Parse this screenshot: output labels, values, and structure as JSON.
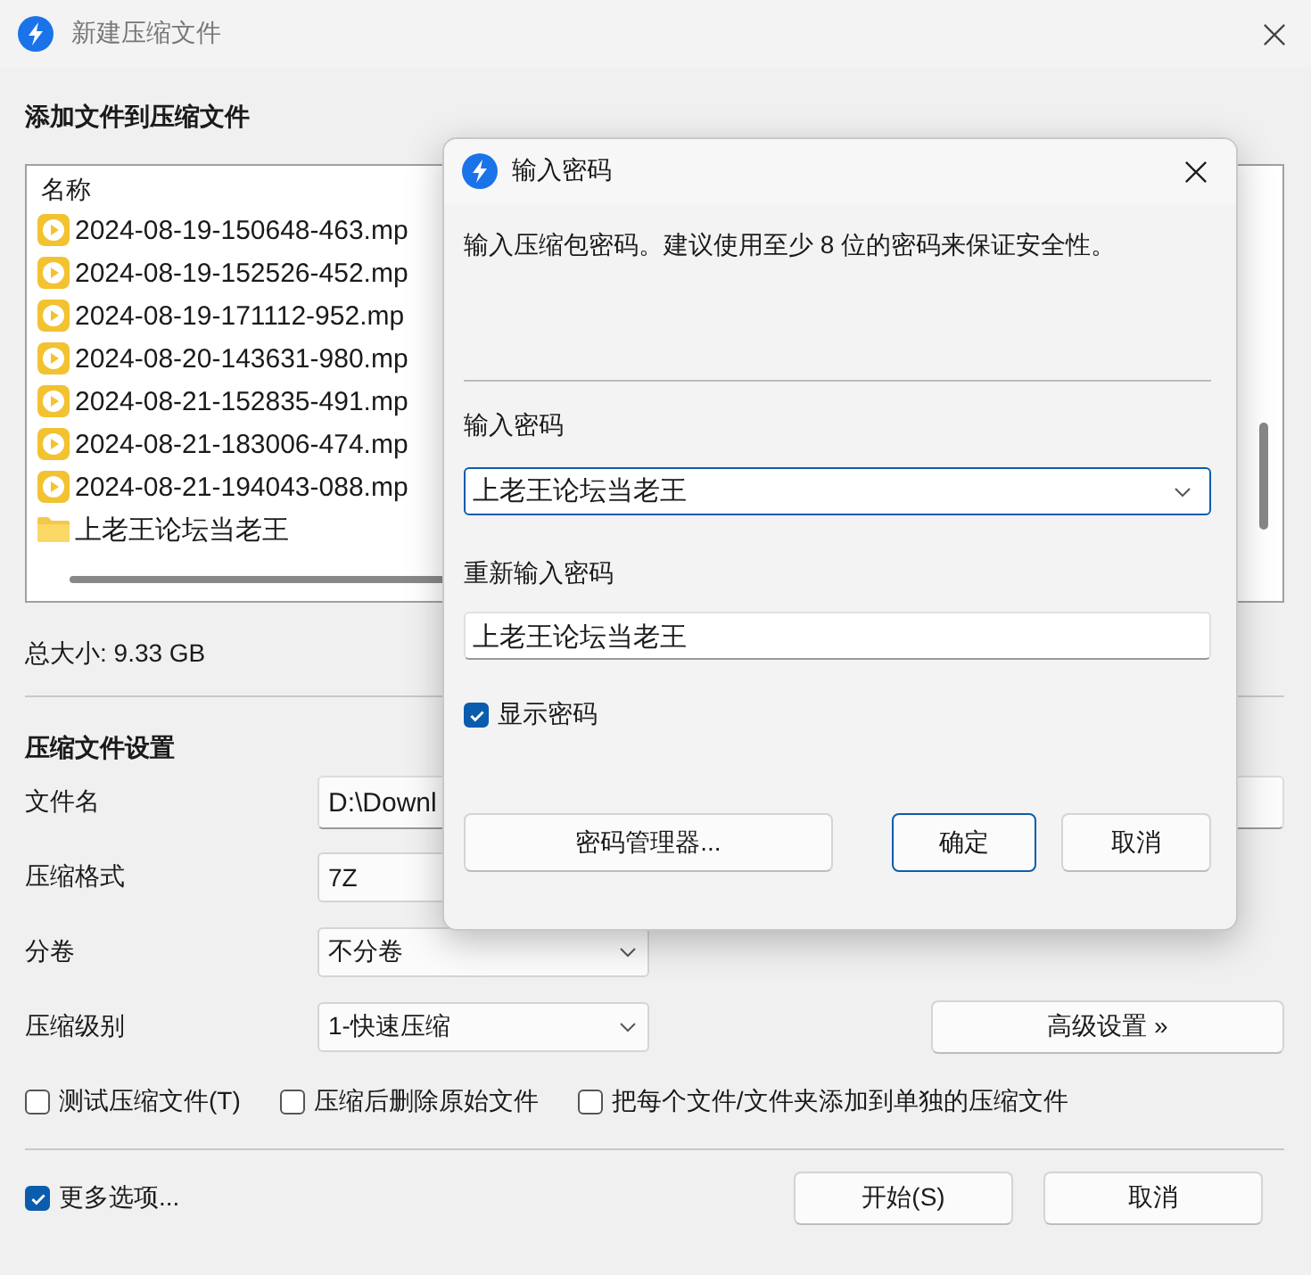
{
  "window": {
    "title": "新建压缩文件"
  },
  "files": {
    "heading": "添加文件到压缩文件",
    "column": "名称",
    "items": [
      {
        "name": "2024-08-19-150648-463.mp",
        "kind": "video"
      },
      {
        "name": "2024-08-19-152526-452.mp",
        "kind": "video"
      },
      {
        "name": "2024-08-19-171112-952.mp",
        "kind": "video"
      },
      {
        "name": "2024-08-20-143631-980.mp",
        "kind": "video"
      },
      {
        "name": "2024-08-21-152835-491.mp",
        "kind": "video"
      },
      {
        "name": "2024-08-21-183006-474.mp",
        "kind": "video"
      },
      {
        "name": "2024-08-21-194043-088.mp",
        "kind": "video"
      },
      {
        "name": "上老王论坛当老王",
        "kind": "folder"
      }
    ]
  },
  "total_size": "总大小: 9.33 GB",
  "settings": {
    "heading": "压缩文件设置",
    "fields": [
      {
        "label": "文件名",
        "value": "D:\\Downl",
        "kind": "text"
      },
      {
        "label": "压缩格式",
        "value": "7Z",
        "kind": "box"
      },
      {
        "label": "分卷",
        "value": "不分卷",
        "kind": "select"
      },
      {
        "label": "压缩级别",
        "value": "1-快速压缩",
        "kind": "select"
      }
    ],
    "advanced_button": "高级设置 »",
    "options": [
      {
        "label": "测试压缩文件(T)",
        "checked": false
      },
      {
        "label": "压缩后删除原始文件",
        "checked": false
      },
      {
        "label": "把每个文件/文件夹添加到单独的压缩文件",
        "checked": false
      }
    ]
  },
  "more_options": {
    "label": "更多选项...",
    "checked": true
  },
  "buttons": [
    "开始(S)",
    "取消"
  ],
  "dialog": {
    "title": "输入密码",
    "description": "输入压缩包密码。建议使用至少 8 位的密码来保证安全性。",
    "password_label": "输入密码",
    "password": "上老王论坛当老王",
    "confirm_label": "重新输入密码",
    "confirm": "上老王论坛当老王",
    "show_password": {
      "label": "显示密码",
      "checked": true
    },
    "buttons": [
      {
        "label": "密码管理器...",
        "default": false
      },
      {
        "label": "确定",
        "default": true
      },
      {
        "label": "取消",
        "default": false
      }
    ]
  }
}
